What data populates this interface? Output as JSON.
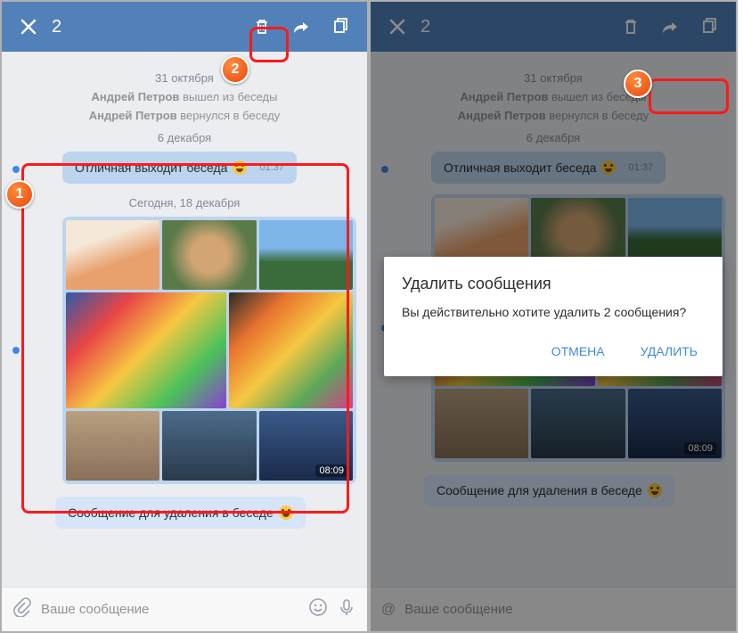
{
  "left": {
    "header": {
      "count": "2"
    },
    "date1": "31 октября",
    "sys1_user": "Андрей Петров",
    "sys1_action": "вышел из беседы",
    "sys2_user": "Андрей Петров",
    "sys2_action": "вернулся в беседу",
    "date2": "6 декабря",
    "msg1": "Отличная выходит беседа",
    "msg1_time": "01:37",
    "date3": "Сегодня, 18 декабря",
    "grid_time": "08:09",
    "msg2": "Сообщение для удаления в беседе",
    "input_placeholder": "Ваше сообщение"
  },
  "right": {
    "date1": "31 октября",
    "sys1_user": "Андрей Петров",
    "sys1_action": "вышел из беседы",
    "sys2_user": "Андрей Петров",
    "sys2_action": "вернулся в беседу",
    "date2": "6 декабря",
    "msg1": "Отличная выходит беседа",
    "msg1_time": "01:37",
    "msg2": "Сообщение для удаления в беседе",
    "grid_time": "08:09",
    "dialog": {
      "title": "Удалить сообщения",
      "body": "Вы действительно хотите удалить 2 сообщения?",
      "cancel": "ОТМЕНА",
      "confirm": "УДАЛИТЬ"
    }
  },
  "badges": {
    "b1": "1",
    "b2": "2",
    "b3": "3"
  }
}
